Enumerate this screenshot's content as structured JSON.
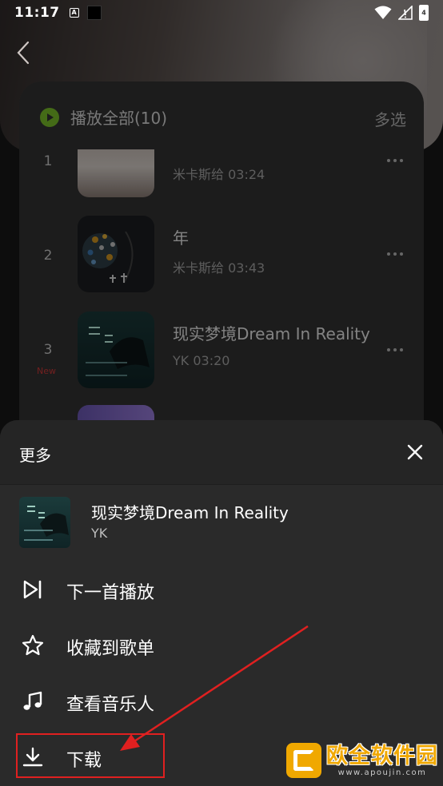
{
  "status_bar": {
    "time": "11:17",
    "notif_letter": "A",
    "battery_pct": "4"
  },
  "playlist": {
    "play_all": "播放全部(10)",
    "multi_select": "多选",
    "songs": [
      {
        "num": "1",
        "title": "",
        "meta": "米卡斯给 03:24",
        "new": ""
      },
      {
        "num": "2",
        "title": "年",
        "meta": "米卡斯给 03:43",
        "new": ""
      },
      {
        "num": "3",
        "title": "现实梦境Dream In Reality",
        "meta": "YK 03:20",
        "new": "New"
      },
      {
        "num": "",
        "title": "",
        "meta": "",
        "new": ""
      }
    ]
  },
  "sheet": {
    "title": "更多",
    "song_title": "现实梦境Dream In Reality",
    "song_artist": "YK",
    "items": [
      {
        "label": "下一首播放",
        "icon": "play-next-icon"
      },
      {
        "label": "收藏到歌单",
        "icon": "star-icon"
      },
      {
        "label": "查看音乐人",
        "icon": "music-note-icon"
      },
      {
        "label": "下载",
        "icon": "download-icon"
      }
    ]
  },
  "watermark": {
    "text": "欧全软件园",
    "url": "www.apoujin.com"
  },
  "colors": {
    "highlight": "#e02020",
    "play_green": "#7cc42a",
    "new_red": "#d23a3a",
    "watermark_gold": "#f0a800"
  }
}
